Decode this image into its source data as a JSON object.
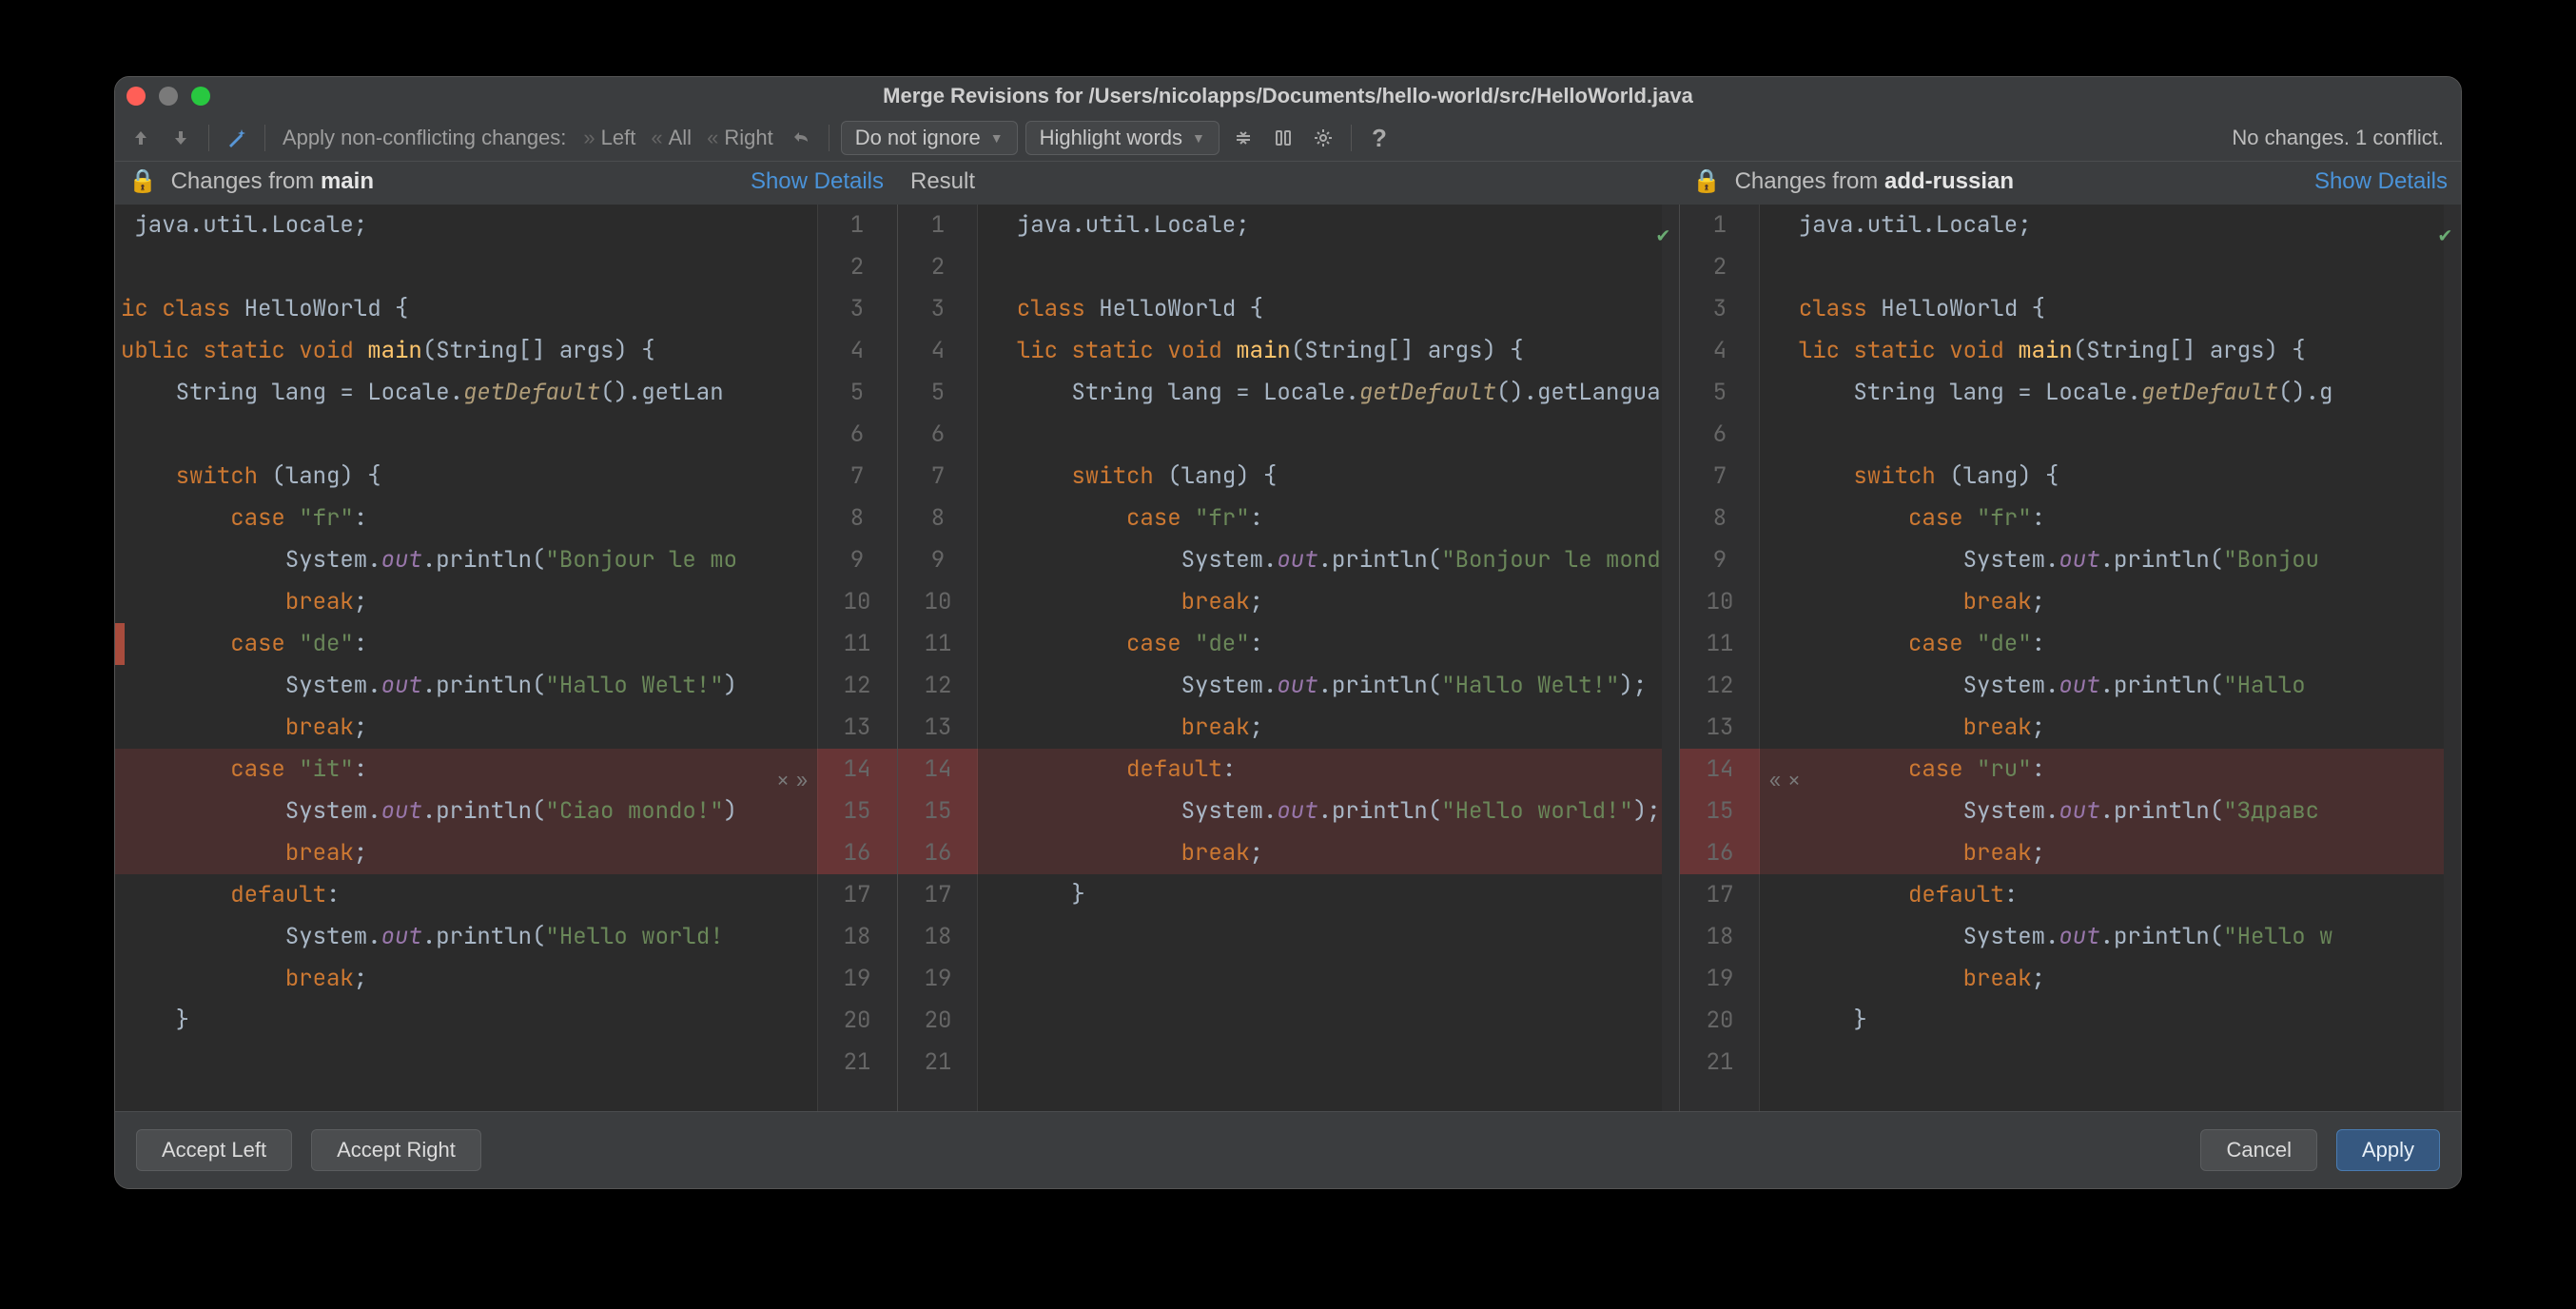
{
  "title": "Merge Revisions for /Users/nicolapps/Documents/hello-world/src/HelloWorld.java",
  "toolbar": {
    "apply_label": "Apply non-conflicting changes:",
    "chips": {
      "left": "Left",
      "all": "All",
      "right": "Right"
    },
    "select_ignore": "Do not ignore",
    "select_highlight": "Highlight words"
  },
  "status": "No changes. 1 conflict.",
  "headers": {
    "left_prefix": "Changes from ",
    "left_branch": "main",
    "result": "Result",
    "right_prefix": "Changes from ",
    "right_branch": "add-russian",
    "show_details": "Show Details"
  },
  "footer": {
    "accept_left": "Accept Left",
    "accept_right": "Accept Right",
    "cancel": "Cancel",
    "apply": "Apply"
  },
  "left_lines": [
    [
      1,
      [
        [
          " ",
          "id"
        ],
        [
          "java.util.Locale",
          null
        ],
        [
          ";",
          "op"
        ]
      ]
    ],
    [
      2,
      []
    ],
    [
      3,
      [
        [
          "ic ",
          "kw"
        ],
        [
          "class ",
          "kw"
        ],
        [
          "HelloWorld {",
          "id"
        ]
      ]
    ],
    [
      4,
      [
        [
          "ublic ",
          "kw"
        ],
        [
          "static ",
          "kw"
        ],
        [
          "void ",
          "kw"
        ],
        [
          "main",
          "fn"
        ],
        [
          "(String[] args) {",
          "id"
        ]
      ]
    ],
    [
      5,
      [
        [
          "    String lang = Locale.",
          "id"
        ],
        [
          "getDefault",
          "meth"
        ],
        [
          "().getLan",
          "id"
        ]
      ]
    ],
    [
      6,
      []
    ],
    [
      7,
      [
        [
          "    ",
          "id"
        ],
        [
          "switch ",
          "kw"
        ],
        [
          "(lang) {",
          "id"
        ]
      ]
    ],
    [
      8,
      [
        [
          "        ",
          "id"
        ],
        [
          "case ",
          "kw"
        ],
        [
          "\"fr\"",
          "str"
        ],
        [
          ":",
          "op"
        ]
      ]
    ],
    [
      9,
      [
        [
          "            System.",
          "id"
        ],
        [
          "out",
          "fld"
        ],
        [
          ".println(",
          "id"
        ],
        [
          "\"Bonjour le mo",
          "str"
        ]
      ]
    ],
    [
      10,
      [
        [
          "            ",
          "id"
        ],
        [
          "break",
          "kw"
        ],
        [
          ";",
          "op"
        ]
      ]
    ],
    [
      11,
      [
        [
          "        ",
          "id"
        ],
        [
          "case ",
          "kw"
        ],
        [
          "\"de\"",
          "str"
        ],
        [
          ":",
          "op"
        ]
      ]
    ],
    [
      12,
      [
        [
          "            System.",
          "id"
        ],
        [
          "out",
          "fld"
        ],
        [
          ".println(",
          "id"
        ],
        [
          "\"Hallo Welt!\"",
          "str"
        ],
        [
          ")",
          "id"
        ]
      ]
    ],
    [
      13,
      [
        [
          "            ",
          "id"
        ],
        [
          "break",
          "kw"
        ],
        [
          ";",
          "op"
        ]
      ]
    ],
    [
      14,
      [
        [
          "        ",
          "id"
        ],
        [
          "case ",
          "kw"
        ],
        [
          "\"it\"",
          "str"
        ],
        [
          ":",
          "op"
        ]
      ]
    ],
    [
      15,
      [
        [
          "            System.",
          "id"
        ],
        [
          "out",
          "fld"
        ],
        [
          ".println(",
          "id"
        ],
        [
          "\"Ciao mondo!\"",
          "str"
        ],
        [
          ")",
          "id"
        ]
      ]
    ],
    [
      16,
      [
        [
          "            ",
          "id"
        ],
        [
          "break",
          "kw"
        ],
        [
          ";",
          "op"
        ]
      ]
    ],
    [
      17,
      [
        [
          "        ",
          "id"
        ],
        [
          "default",
          "kw"
        ],
        [
          ":",
          "op"
        ]
      ]
    ],
    [
      18,
      [
        [
          "            System.",
          "id"
        ],
        [
          "out",
          "fld"
        ],
        [
          ".println(",
          "id"
        ],
        [
          "\"Hello world!",
          "str"
        ]
      ]
    ],
    [
      19,
      [
        [
          "            ",
          "id"
        ],
        [
          "break",
          "kw"
        ],
        [
          ";",
          "op"
        ]
      ]
    ],
    [
      20,
      [
        [
          "    }",
          "id"
        ]
      ]
    ],
    [
      21,
      []
    ]
  ],
  "mid_lines": [
    [
      1,
      [
        [
          "  java.util.Locale",
          null
        ],
        [
          ";",
          "op"
        ]
      ]
    ],
    [
      2,
      []
    ],
    [
      3,
      [
        [
          "  ",
          "id"
        ],
        [
          "class ",
          "kw"
        ],
        [
          "HelloWorld {",
          "id"
        ]
      ]
    ],
    [
      4,
      [
        [
          "  ",
          "id"
        ],
        [
          "lic ",
          "kw"
        ],
        [
          "static ",
          "kw"
        ],
        [
          "void ",
          "kw"
        ],
        [
          "main",
          "fn"
        ],
        [
          "(String[] args) {",
          "id"
        ]
      ]
    ],
    [
      5,
      [
        [
          "      String lang = Locale.",
          "id"
        ],
        [
          "getDefault",
          "meth"
        ],
        [
          "().getLanguage();",
          "id"
        ]
      ]
    ],
    [
      6,
      []
    ],
    [
      7,
      [
        [
          "      ",
          "id"
        ],
        [
          "switch ",
          "kw"
        ],
        [
          "(lang) {",
          "id"
        ]
      ]
    ],
    [
      8,
      [
        [
          "          ",
          "id"
        ],
        [
          "case ",
          "kw"
        ],
        [
          "\"fr\"",
          "str"
        ],
        [
          ":",
          "op"
        ]
      ]
    ],
    [
      9,
      [
        [
          "              System.",
          "id"
        ],
        [
          "out",
          "fld"
        ],
        [
          ".println(",
          "id"
        ],
        [
          "\"Bonjour le monde !\"",
          "str"
        ],
        [
          ");",
          "id"
        ]
      ]
    ],
    [
      10,
      [
        [
          "              ",
          "id"
        ],
        [
          "break",
          "kw"
        ],
        [
          ";",
          "op"
        ]
      ]
    ],
    [
      11,
      [
        [
          "          ",
          "id"
        ],
        [
          "case ",
          "kw"
        ],
        [
          "\"de\"",
          "str"
        ],
        [
          ":",
          "op"
        ]
      ]
    ],
    [
      12,
      [
        [
          "              System.",
          "id"
        ],
        [
          "out",
          "fld"
        ],
        [
          ".println(",
          "id"
        ],
        [
          "\"Hallo Welt!\"",
          "str"
        ],
        [
          ");",
          "id"
        ]
      ]
    ],
    [
      13,
      [
        [
          "              ",
          "id"
        ],
        [
          "break",
          "kw"
        ],
        [
          ";",
          "op"
        ]
      ]
    ],
    [
      14,
      [
        [
          "          ",
          "id"
        ],
        [
          "default",
          "kw"
        ],
        [
          ":",
          "op"
        ]
      ]
    ],
    [
      15,
      [
        [
          "              System.",
          "id"
        ],
        [
          "out",
          "fld"
        ],
        [
          ".println(",
          "id"
        ],
        [
          "\"Hello world!\"",
          "str"
        ],
        [
          ");",
          "id"
        ]
      ]
    ],
    [
      16,
      [
        [
          "              ",
          "id"
        ],
        [
          "break",
          "kw"
        ],
        [
          ";",
          "op"
        ]
      ]
    ],
    [
      17,
      [
        [
          "      }",
          "id"
        ]
      ]
    ],
    [
      18,
      []
    ],
    [
      19,
      []
    ],
    [
      20,
      []
    ],
    [
      21,
      []
    ]
  ],
  "right_lines": [
    [
      1,
      [
        [
          "  java.util.Locale",
          null
        ],
        [
          ";",
          "op"
        ]
      ]
    ],
    [
      2,
      []
    ],
    [
      3,
      [
        [
          "  ",
          "id"
        ],
        [
          "class ",
          "kw"
        ],
        [
          "HelloWorld {",
          "id"
        ]
      ]
    ],
    [
      4,
      [
        [
          "  ",
          "id"
        ],
        [
          "lic ",
          "kw"
        ],
        [
          "static ",
          "kw"
        ],
        [
          "void ",
          "kw"
        ],
        [
          "main",
          "fn"
        ],
        [
          "(String[] args) {",
          "id"
        ]
      ]
    ],
    [
      5,
      [
        [
          "      String lang = Locale.",
          "id"
        ],
        [
          "getDefault",
          "meth"
        ],
        [
          "().g",
          "id"
        ]
      ]
    ],
    [
      6,
      []
    ],
    [
      7,
      [
        [
          "      ",
          "id"
        ],
        [
          "switch ",
          "kw"
        ],
        [
          "(lang) {",
          "id"
        ]
      ]
    ],
    [
      8,
      [
        [
          "          ",
          "id"
        ],
        [
          "case ",
          "kw"
        ],
        [
          "\"fr\"",
          "str"
        ],
        [
          ":",
          "op"
        ]
      ]
    ],
    [
      9,
      [
        [
          "              System.",
          "id"
        ],
        [
          "out",
          "fld"
        ],
        [
          ".println(",
          "id"
        ],
        [
          "\"Bonjou",
          "str"
        ]
      ]
    ],
    [
      10,
      [
        [
          "              ",
          "id"
        ],
        [
          "break",
          "kw"
        ],
        [
          ";",
          "op"
        ]
      ]
    ],
    [
      11,
      [
        [
          "          ",
          "id"
        ],
        [
          "case ",
          "kw"
        ],
        [
          "\"de\"",
          "str"
        ],
        [
          ":",
          "op"
        ]
      ]
    ],
    [
      12,
      [
        [
          "              System.",
          "id"
        ],
        [
          "out",
          "fld"
        ],
        [
          ".println(",
          "id"
        ],
        [
          "\"Hallo ",
          "str"
        ]
      ]
    ],
    [
      13,
      [
        [
          "              ",
          "id"
        ],
        [
          "break",
          "kw"
        ],
        [
          ";",
          "op"
        ]
      ]
    ],
    [
      14,
      [
        [
          "          ",
          "id"
        ],
        [
          "case ",
          "kw"
        ],
        [
          "\"ru\"",
          "str"
        ],
        [
          ":",
          "op"
        ]
      ]
    ],
    [
      15,
      [
        [
          "              System.",
          "id"
        ],
        [
          "out",
          "fld"
        ],
        [
          ".println(",
          "id"
        ],
        [
          "\"Здравс",
          "str"
        ]
      ]
    ],
    [
      16,
      [
        [
          "              ",
          "id"
        ],
        [
          "break",
          "kw"
        ],
        [
          ";",
          "op"
        ]
      ]
    ],
    [
      17,
      [
        [
          "          ",
          "id"
        ],
        [
          "default",
          "kw"
        ],
        [
          ":",
          "op"
        ]
      ]
    ],
    [
      18,
      [
        [
          "              System.",
          "id"
        ],
        [
          "out",
          "fld"
        ],
        [
          ".println(",
          "id"
        ],
        [
          "\"Hello w",
          "str"
        ]
      ]
    ],
    [
      19,
      [
        [
          "              ",
          "id"
        ],
        [
          "break",
          "kw"
        ],
        [
          ";",
          "op"
        ]
      ]
    ],
    [
      20,
      [
        [
          "      }",
          "id"
        ]
      ]
    ],
    [
      21,
      []
    ]
  ],
  "conflict_lines_left": [
    14,
    15,
    16
  ],
  "conflict_lines_mid": [
    14,
    15,
    16
  ],
  "conflict_lines_right": [
    14,
    15,
    16
  ]
}
